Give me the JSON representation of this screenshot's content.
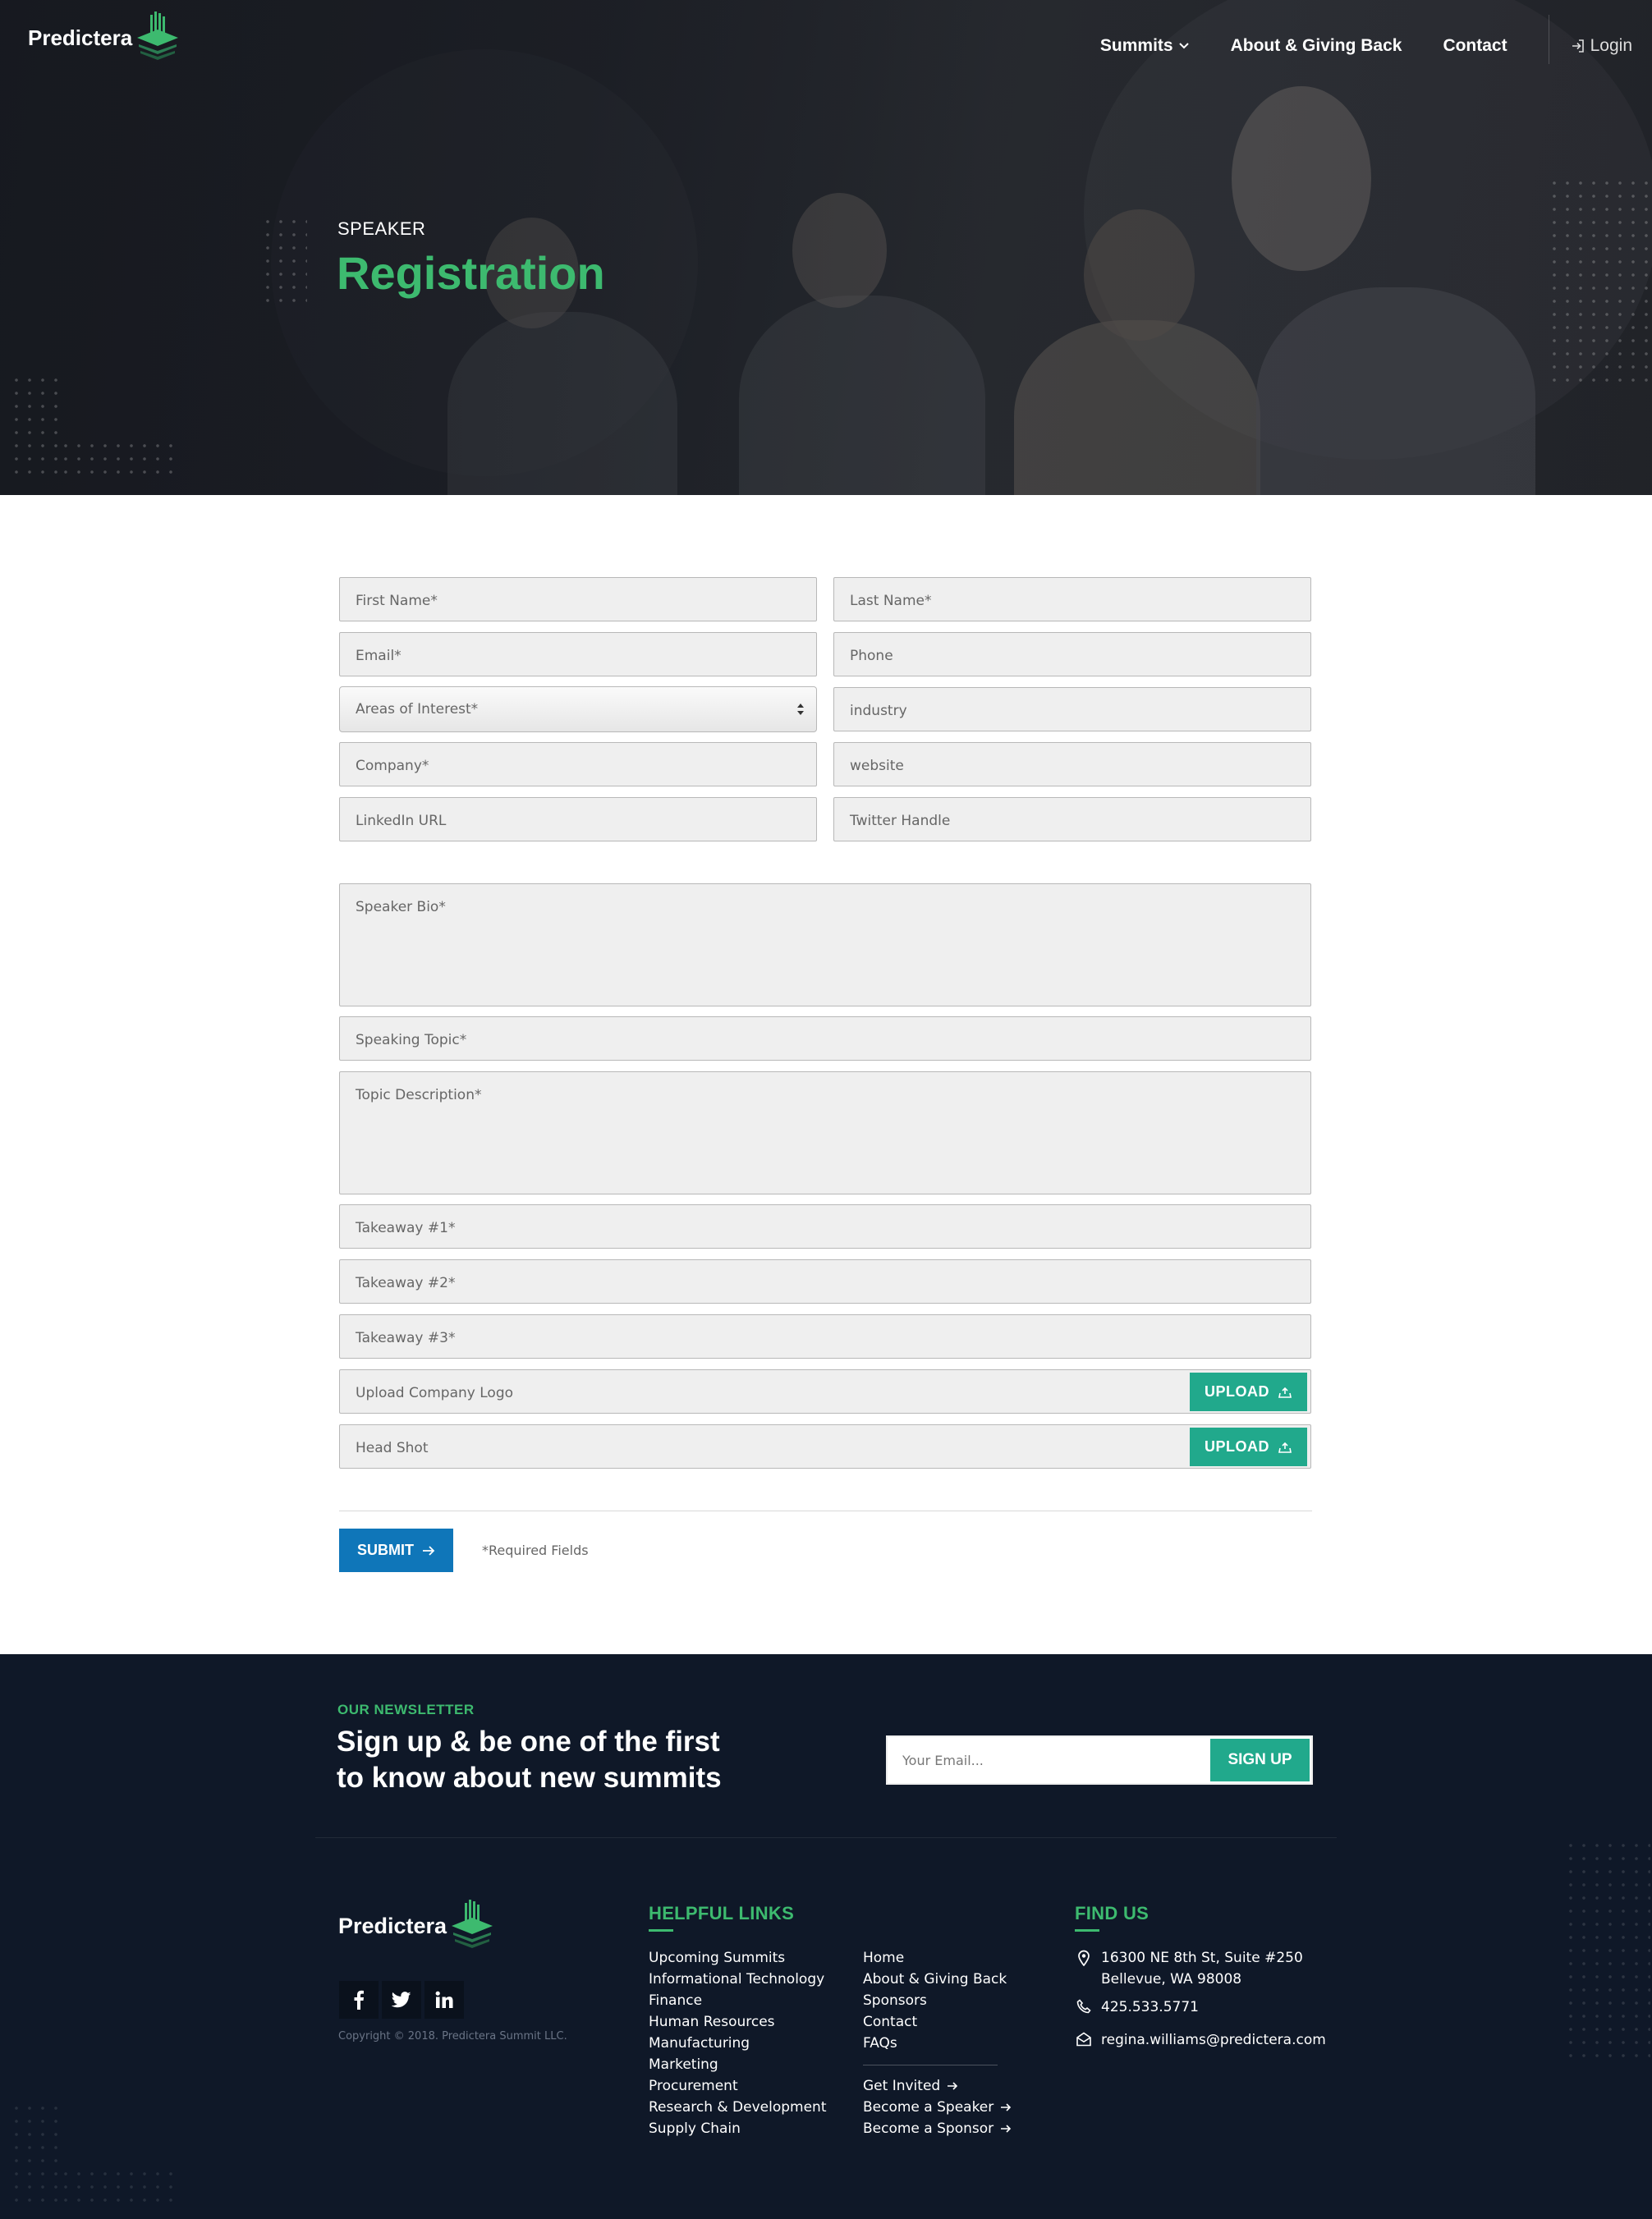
{
  "brand": {
    "name": "Predictera"
  },
  "nav": {
    "items": [
      {
        "label": "Summits"
      },
      {
        "label": "About & Giving Back"
      },
      {
        "label": "Contact"
      }
    ],
    "login_label": "Login"
  },
  "hero": {
    "eyebrow": "SPEAKER",
    "title": "Registration"
  },
  "form": {
    "first_name": "First Name*",
    "last_name": "Last Name*",
    "email": "Email*",
    "phone": "Phone",
    "areas_of_interest": "Areas of Interest*",
    "industry": "industry",
    "company": "Company*",
    "website": "website",
    "linkedin": "LinkedIn URL",
    "twitter": "Twitter Handle",
    "speaker_bio": "Speaker Bio*",
    "speaking_topic": "Speaking Topic*",
    "topic_description": "Topic Description*",
    "takeaway_1": "Takeaway #1*",
    "takeaway_2": "Takeaway #2*",
    "takeaway_3": "Takeaway #3*",
    "company_logo": "Upload Company Logo",
    "head_shot": "Head Shot",
    "upload_label": "UPLOAD",
    "submit_label": "SUBMIT",
    "required_note": "*Required Fields"
  },
  "newsletter": {
    "label": "OUR NEWSLETTER",
    "title_line1": "Sign up & be one of the first",
    "title_line2": "to know about new summits",
    "email_placeholder": "Your Email...",
    "signup_label": "SIGN UP"
  },
  "footer": {
    "copyright": "Copyright © 2018. Predictera Summit LLC.",
    "helpful_links_title": "HELPFUL LINKS",
    "links_col1": [
      "Upcoming Summits",
      "Informational Technology",
      "Finance",
      "Human Resources",
      "Manufacturing",
      "Marketing",
      "Procurement",
      "Research & Development",
      "Supply Chain"
    ],
    "links_col2": [
      "Home",
      "About & Giving Back",
      "Sponsors",
      "Contact",
      "FAQs"
    ],
    "links_col2_cta": [
      "Get Invited",
      "Become a Speaker",
      "Become a Sponsor"
    ],
    "find_us_title": "FIND US",
    "address_line1": "16300 NE 8th St, Suite #250",
    "address_line2": "Bellevue, WA 98008",
    "phone": "425.533.5771",
    "email": "regina.williams@predictera.com"
  },
  "colors": {
    "accent_green": "#3dba6f",
    "teal_button": "#21a98c",
    "submit_blue": "#0f76b9",
    "footer_bg": "#0f1828"
  },
  "icons": [
    "chevron-down-icon",
    "login-icon",
    "select-arrows-icon",
    "upload-icon",
    "arrow-right-icon",
    "facebook-icon",
    "twitter-icon",
    "linkedin-icon",
    "location-icon",
    "phone-icon",
    "email-icon"
  ]
}
